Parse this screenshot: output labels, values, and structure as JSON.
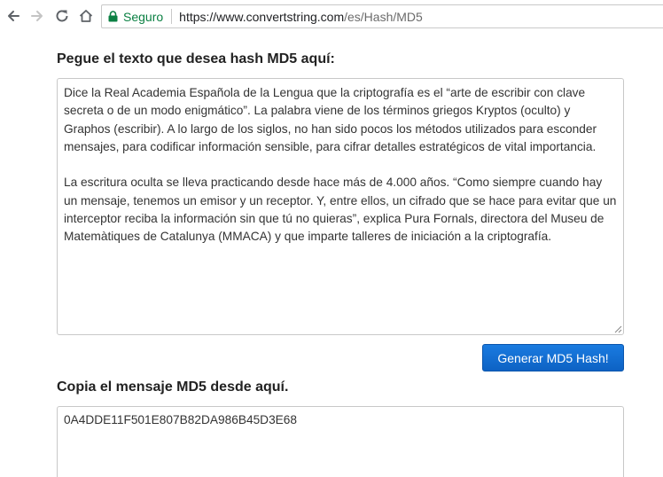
{
  "browser": {
    "secure_label": "Seguro",
    "url_host": "https://www.convertstring.com",
    "url_path": "/es/Hash/MD5"
  },
  "main": {
    "input_heading": "Pegue el texto que desea hash MD5 aquí:",
    "input_paragraphs": [
      "Dice la Real Academia Española de la Lengua que la criptografía es el “arte de escribir con clave secreta o de un modo enigmático”. La palabra viene de los términos griegos Kryptos (oculto) y Graphos (escribir). A lo largo de los siglos, no han sido pocos los métodos utilizados para esconder mensajes, para codificar información sensible, para cifrar detalles estratégicos de vital importancia.",
      "La escritura oculta se lleva practicando desde hace más de 4.000 años. “Como siempre cuando hay un mensaje, tenemos un emisor y un receptor. Y, entre ellos, un cifrado que se hace para evitar que un interceptor reciba la información sin que tú no quieras”, explica Pura Fornals, directora del Museu de Matemàtiques de Catalunya (MMACA) y que imparte talleres de iniciación a la criptografía."
    ],
    "generate_button": "Generar MD5 Hash!",
    "output_heading": "Copia el mensaje MD5 desde aquí.",
    "output_value": "0A4DDE11F501E807B82DA986B45D3E68"
  },
  "colors": {
    "secure_green": "#0b8043",
    "button_blue": "#1a6fd6"
  },
  "icons": [
    "back-arrow-icon",
    "forward-arrow-icon",
    "reload-icon",
    "home-icon",
    "lock-icon",
    "resize-grip-icon"
  ]
}
